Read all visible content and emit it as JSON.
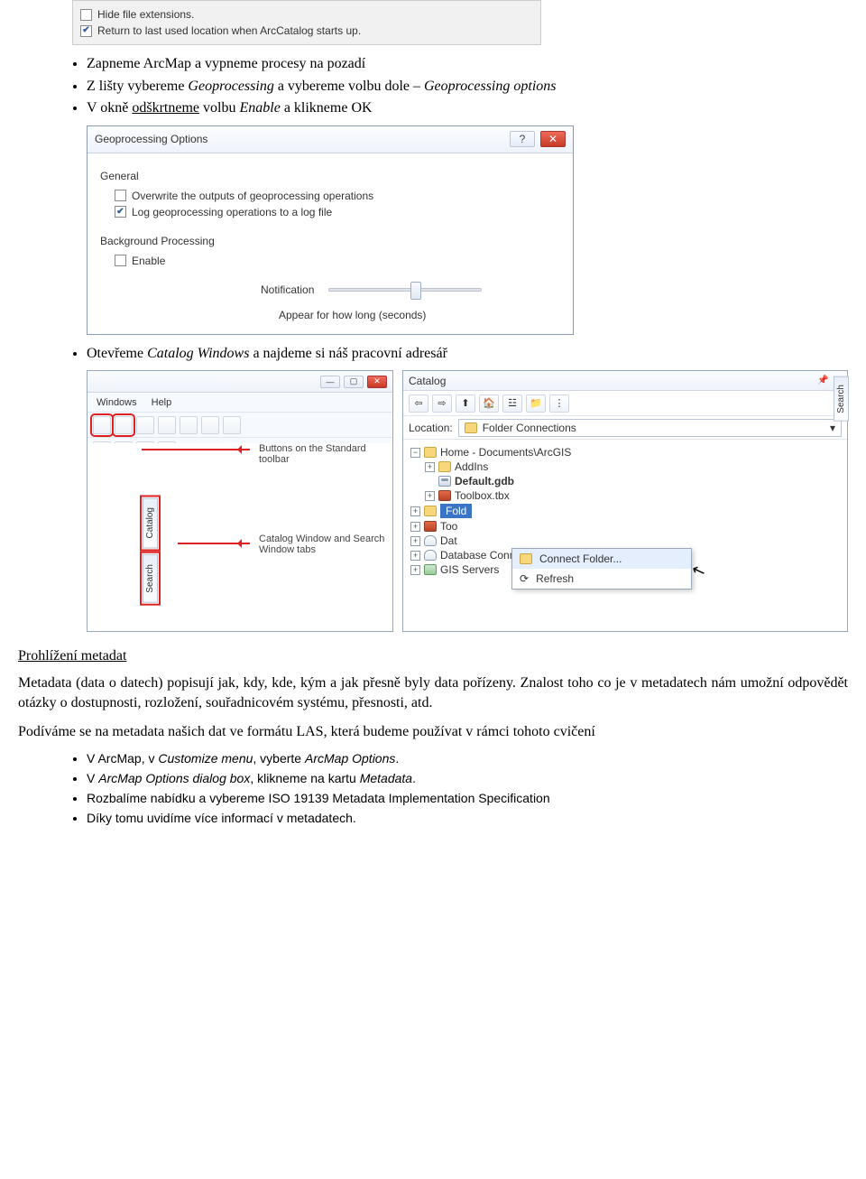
{
  "top_panel": {
    "opt1": "Hide file extensions.",
    "opt2": "Return to last used location when ArcCatalog starts up."
  },
  "bullets_a": {
    "b1_pre": "Zapneme ArcMap a vypneme procesy na pozadí",
    "b2_pre": "Z lišty vybereme ",
    "b2_it1": "Geoprocessing",
    "b2_mid": "  a vybereme volbu dole – ",
    "b2_it2": "Geoprocessing options",
    "b3_pre": "V okně ",
    "b3_u": "odškrtneme",
    "b3_mid": " volbu ",
    "b3_it": "Enable",
    "b3_post": " a klikneme OK"
  },
  "dialog": {
    "title": "Geoprocessing Options",
    "group_general": "General",
    "opt_overwrite": "Overwrite the outputs of geoprocessing operations",
    "opt_log": "Log geoprocessing operations to a log file",
    "group_bg": "Background Processing",
    "opt_enable": "Enable",
    "notification": "Notification",
    "appear": "Appear for how long (seconds)"
  },
  "bullets_b": {
    "b4_pre": "Otevřeme ",
    "b4_it": "Catalog Windows",
    "b4_post": " a najdeme si náš pracovní adresář"
  },
  "left_app": {
    "menu_windows": "Windows",
    "menu_help": "Help",
    "callout1": "Buttons on the Standard toolbar",
    "callout2": "Catalog Window and Search Window tabs",
    "tab_catalog": "Catalog",
    "tab_search": "Search"
  },
  "catalog": {
    "title": "Catalog",
    "loc_label": "Location:",
    "loc_value": "Folder Connections",
    "home": "Home - Documents\\ArcGIS",
    "addins": "AddIns",
    "defaultgdb": "Default.gdb",
    "toolbox": "Toolbox.tbx",
    "fold": "Fold",
    "too": "Too",
    "dat": "Dat",
    "dbconn": "Database Connections",
    "gis": "GIS Servers",
    "ctx_connect": "Connect Folder...",
    "ctx_refresh": "Refresh",
    "search_tab": "Search"
  },
  "section_heading": "Prohlížení metadat",
  "para1": "Metadata (data o datech) popisují jak, kdy, kde, kým a jak přesně byly data pořízeny. Znalost toho co je v metadatech nám umožní odpovědět otázky o dostupnosti, rozložení, souřadnicovém systému, přesnosti, atd.",
  "para2": "Podíváme se na metadata našich dat ve formátu LAS, která budeme používat v rámci tohoto cvičení",
  "bullets_c": {
    "c1_pre": "V ArcMap, v ",
    "c1_it1": "Customize menu",
    "c1_mid": ", vyberte ",
    "c1_it2": "ArcMap Options",
    "c1_post": ".",
    "c2_pre": "V ",
    "c2_it": "ArcMap Options dialog box",
    "c2_mid": ", klikneme na kartu ",
    "c2_it2": "Metadata",
    "c2_post": ".",
    "c3": "Rozbalíme nabídku a vybereme ISO 19139 Metadata Implementation Specification",
    "c4": "Díky tomu uvidíme více informací v metadatech."
  }
}
